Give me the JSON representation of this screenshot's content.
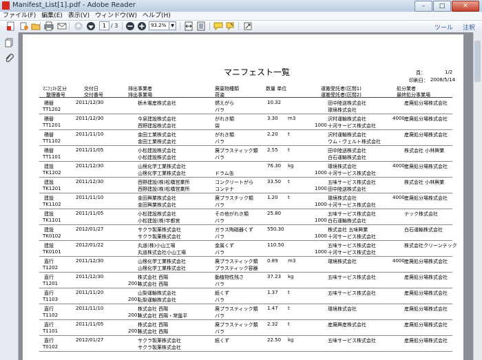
{
  "window": {
    "title": "Manifest_List[1].pdf - Adobe Reader"
  },
  "menu": [
    "ファイル(F)",
    "編集(E)",
    "表示(V)",
    "ウィンドウ(W)",
    "ヘルプ(H)"
  ],
  "toolbar": {
    "page_current": "1",
    "page_total": "/ 3",
    "zoom": "93.2%",
    "tools_link": "ツール",
    "comment_link": "注釈"
  },
  "document": {
    "title": "マニフェスト一覧",
    "page_label": "頁：",
    "page_value": "1/2",
    "printed_label": "印刷日：",
    "printed_value": "2008/5/14",
    "headers": {
      "h1a": "ﾏﾆﾌｪｽﾄ区分",
      "h1b": "整理番号",
      "h2a": "交付日",
      "h2b": "交付番号",
      "h3a": "排出事業者",
      "h3b": "排出事業場",
      "h4a": "廃棄物種類",
      "h4b": "荷姿",
      "h5": "数量  単位",
      "h6a": "運搬受託者(区間1)",
      "h6b": "運搬受託者(区間2)",
      "h7a": "処分業者",
      "h7b": "最終処分事業場"
    },
    "rows": [
      {
        "kind": "積替",
        "no": "TT1202",
        "date": "2011/12/30",
        "code": "",
        "em1": "栃木電産株式会社",
        "em2": "",
        "waste": "燃えがら",
        "pack": "バラ",
        "qty": "10.32",
        "unit": "",
        "sec": "",
        "tr1": "田中陸送株式会社",
        "tr2": "環境株式会社",
        "dsec": "",
        "disp": "産廃処分場株式会社"
      },
      {
        "kind": "積替",
        "no": "TT1201",
        "date": "2011/12/30",
        "code": "",
        "em1": "今泉建設株式会社",
        "em2": "西野建設株式会社",
        "waste": "がれき類",
        "pack": "袋",
        "qty": "3.30",
        "unit": "m3",
        "sec": "1000",
        "tr1": "沢村運輸株式会社",
        "tr2": "十河サービス株式会社",
        "dsec": "4000",
        "disp": "産廃処分場株式会社"
      },
      {
        "kind": "積替",
        "no": "TT1102",
        "date": "2011/11/10",
        "code": "",
        "em1": "金田工業株式会社",
        "em2": "金田工業株式会社",
        "waste": "がれき類",
        "pack": "バラ",
        "qty": "2.20",
        "unit": "t",
        "sec": "",
        "tr1": "沢村運輸株式会社",
        "tr2": "ウム・ヴェルト株式会社",
        "dsec": "",
        "disp": "産廃処分場株式会社"
      },
      {
        "kind": "積替",
        "no": "TT1101",
        "date": "2011/11/05",
        "code": "",
        "em1": "小松建設株式会社",
        "em2": "小松建設株式会社",
        "waste": "廃プラスティック類",
        "pack": "バラ",
        "qty": "2.55",
        "unit": "t",
        "sec": "",
        "tr1": "田中陸送株式会社",
        "tr2": "白石運輸株式会社",
        "dsec": "",
        "disp": "株式会社  小林興業"
      },
      {
        "kind": "建設",
        "no": "TK1202",
        "date": "2011/12/30",
        "code": "",
        "em1": "山根化学工業株式会社",
        "em2": "山根化学工業株式会社",
        "waste": "",
        "pack": "ドラム缶",
        "qty": "76.30",
        "unit": "kg",
        "sec": "1000",
        "tr1": "環境株式会社",
        "tr2": "十河サービス株式会社",
        "dsec": "4000",
        "disp": "産廃処分場株式会社"
      },
      {
        "kind": "建設",
        "no": "TK1201",
        "date": "2011/12/30",
        "code": "",
        "em1": "西野建設(株)松橋営業所",
        "em2": "西野建設(株)松橋営業所",
        "waste": "コンクリートがら",
        "pack": "コンテナ",
        "qty": "33.50",
        "unit": "t",
        "sec": "1000",
        "tr1": "五味サービス株式会社",
        "tr2": "田中陸送株式会社",
        "dsec": "",
        "disp": "株式会社  小林興業"
      },
      {
        "kind": "建設",
        "no": "TK1102",
        "date": "2011/11/10",
        "code": "",
        "em1": "金田興業株式会社",
        "em2": "金田興業株式会社",
        "waste": "廃プラスチック類",
        "pack": "バラ",
        "qty": "1.20",
        "unit": "t",
        "sec": "1000",
        "tr1": "環境株式会社",
        "tr2": "十河サービス株式会社",
        "dsec": "4000",
        "disp": "産廃処分場株式会社"
      },
      {
        "kind": "建設",
        "no": "TK1101",
        "date": "2011/11/05",
        "code": "",
        "em1": "小松建設株式会社",
        "em2": "小松建設(株)宇都宮",
        "waste": "その他がれき類",
        "pack": "バラ",
        "qty": "25.80",
        "unit": "",
        "sec": "1000",
        "tr1": "五味サービス株式会社",
        "tr2": "白石運輸株式会社",
        "dsec": "",
        "disp": "テック株式会社"
      },
      {
        "kind": "建設",
        "no": "TK0102",
        "date": "2012/01/27",
        "code": "",
        "em1": "サクラ製薬株式会社",
        "em2": "サクラ製薬株式会社",
        "waste": "ガラス陶磁器くず",
        "pack": "バラ",
        "qty": "550.30",
        "unit": "",
        "sec": "1000",
        "tr1": "株式会社  五味興業",
        "tr2": "十河サービス株式会社",
        "dsec": "",
        "disp": "白石運輸株式会社"
      },
      {
        "kind": "建設",
        "no": "TK0101",
        "date": "2012/01/22",
        "code": "",
        "em1": "丸道(株)小山工場",
        "em2": "丸道株式会社小山工場",
        "waste": "金属くず",
        "pack": "バラ",
        "qty": "110.50",
        "unit": "",
        "sec": "1000",
        "tr1": "五味サービス株式会社",
        "tr2": "十河サービス株式会社",
        "dsec": "",
        "disp": "株式会社クリーンテック"
      },
      {
        "kind": "直行",
        "no": "T1202",
        "date": "2011/12/30",
        "code": "",
        "em1": "山根化学工業株式会社",
        "em2": "山根化学工業株式会社",
        "waste": "廃プラスティック類",
        "pack": "プラスティック容器",
        "qty": "0.89",
        "unit": "m3",
        "sec": "",
        "tr1": "環境株式会社",
        "tr2": "",
        "dsec": "4000",
        "disp": "産廃処分場株式会社"
      },
      {
        "kind": "直行",
        "no": "T1201",
        "date": "2011/12/30",
        "code": "2001",
        "em1": "株式会社  西陽",
        "em2": "株式会社  西陽",
        "waste": "動植物性残さ",
        "pack": "バラ",
        "qty": "37.23",
        "unit": "kg",
        "sec": "",
        "tr1": "五味サービス株式会社",
        "tr2": "",
        "dsec": "",
        "disp": "産廃処分場株式会社"
      },
      {
        "kind": "直行",
        "no": "T1103",
        "date": "2011/11/20",
        "code": "2001",
        "em1": "山梨運輸株式会社",
        "em2": "山梨運輸株式会社",
        "waste": "紙くず",
        "pack": "バラ",
        "qty": "1.37",
        "unit": "t",
        "sec": "",
        "tr1": "五味サービス株式会社",
        "tr2": "",
        "dsec": "",
        "disp": "産廃処分場株式会社"
      },
      {
        "kind": "直行",
        "no": "T1102",
        "date": "2011/11/10",
        "code": "2001",
        "em1": "株式会社  西陽",
        "em2": "株式会社  西陽・常盤平",
        "waste": "廃プラスティック類",
        "pack": "バラ",
        "qty": "1.47",
        "unit": "t",
        "sec": "",
        "tr1": "環境株式会社",
        "tr2": "",
        "dsec": "",
        "disp": "産廃処分場株式会社"
      },
      {
        "kind": "直行",
        "no": "T1101",
        "date": "2011/11/05",
        "code": "2001",
        "em1": "株式会社  西陽",
        "em2": "株式会社  西陽",
        "waste": "廃プラスティック類",
        "pack": "バラ",
        "qty": "2.32",
        "unit": "t",
        "sec": "",
        "tr1": "産廃興産株式会社",
        "tr2": "",
        "dsec": "",
        "disp": "産廃処分場株式会社"
      },
      {
        "kind": "直行",
        "no": "T0102",
        "date": "2012/01/27",
        "code": "",
        "em1": "サクラ製薬株式会社",
        "em2": "サクラ製薬株式会社",
        "waste": "紙くず",
        "pack": "",
        "qty": "22.50",
        "unit": "kg",
        "sec": "",
        "tr1": "五味サービス株式会社",
        "tr2": "",
        "dsec": "",
        "disp": "産廃処分場株式会社"
      }
    ]
  }
}
